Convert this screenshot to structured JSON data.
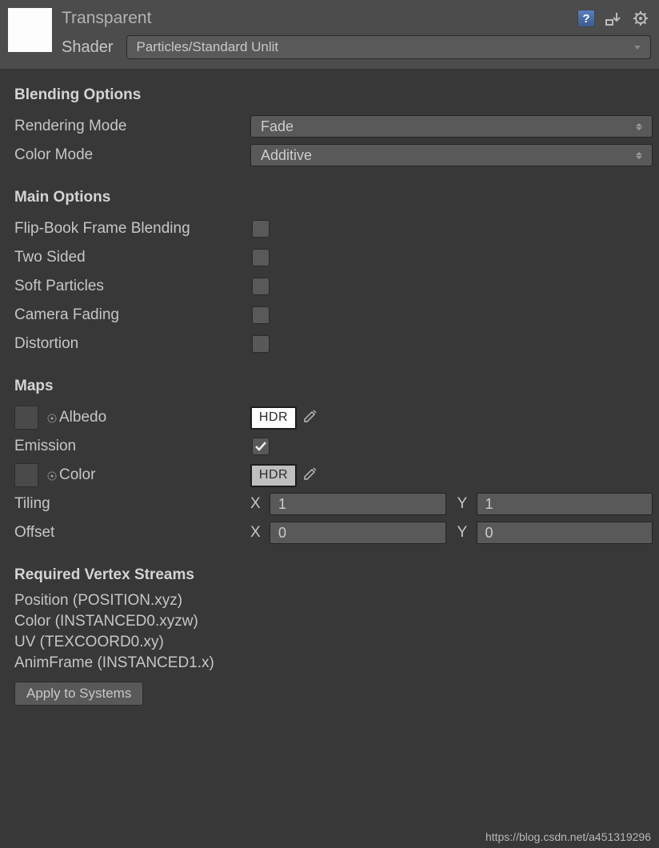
{
  "header": {
    "material_name": "Transparent",
    "shader_label": "Shader",
    "shader_value": "Particles/Standard Unlit"
  },
  "blending": {
    "title": "Blending Options",
    "rendering_mode_label": "Rendering Mode",
    "rendering_mode_value": "Fade",
    "color_mode_label": "Color Mode",
    "color_mode_value": "Additive"
  },
  "main": {
    "title": "Main Options",
    "flipbook_label": "Flip-Book Frame Blending",
    "two_sided_label": "Two Sided",
    "soft_particles_label": "Soft Particles",
    "camera_fading_label": "Camera Fading",
    "distortion_label": "Distortion"
  },
  "maps": {
    "title": "Maps",
    "albedo_label": "Albedo",
    "albedo_hdr": "HDR",
    "emission_label": "Emission",
    "color_label": "Color",
    "color_hdr": "HDR",
    "tiling_label": "Tiling",
    "tiling_x_label": "X",
    "tiling_x": "1",
    "tiling_y_label": "Y",
    "tiling_y": "1",
    "offset_label": "Offset",
    "offset_x_label": "X",
    "offset_x": "0",
    "offset_y_label": "Y",
    "offset_y": "0"
  },
  "streams": {
    "title": "Required Vertex Streams",
    "items": [
      "Position (POSITION.xyz)",
      "Color (INSTANCED0.xyzw)",
      "UV (TEXCOORD0.xy)",
      "AnimFrame (INSTANCED1.x)"
    ],
    "apply_label": "Apply to Systems"
  },
  "watermark": "https://blog.csdn.net/a451319296"
}
